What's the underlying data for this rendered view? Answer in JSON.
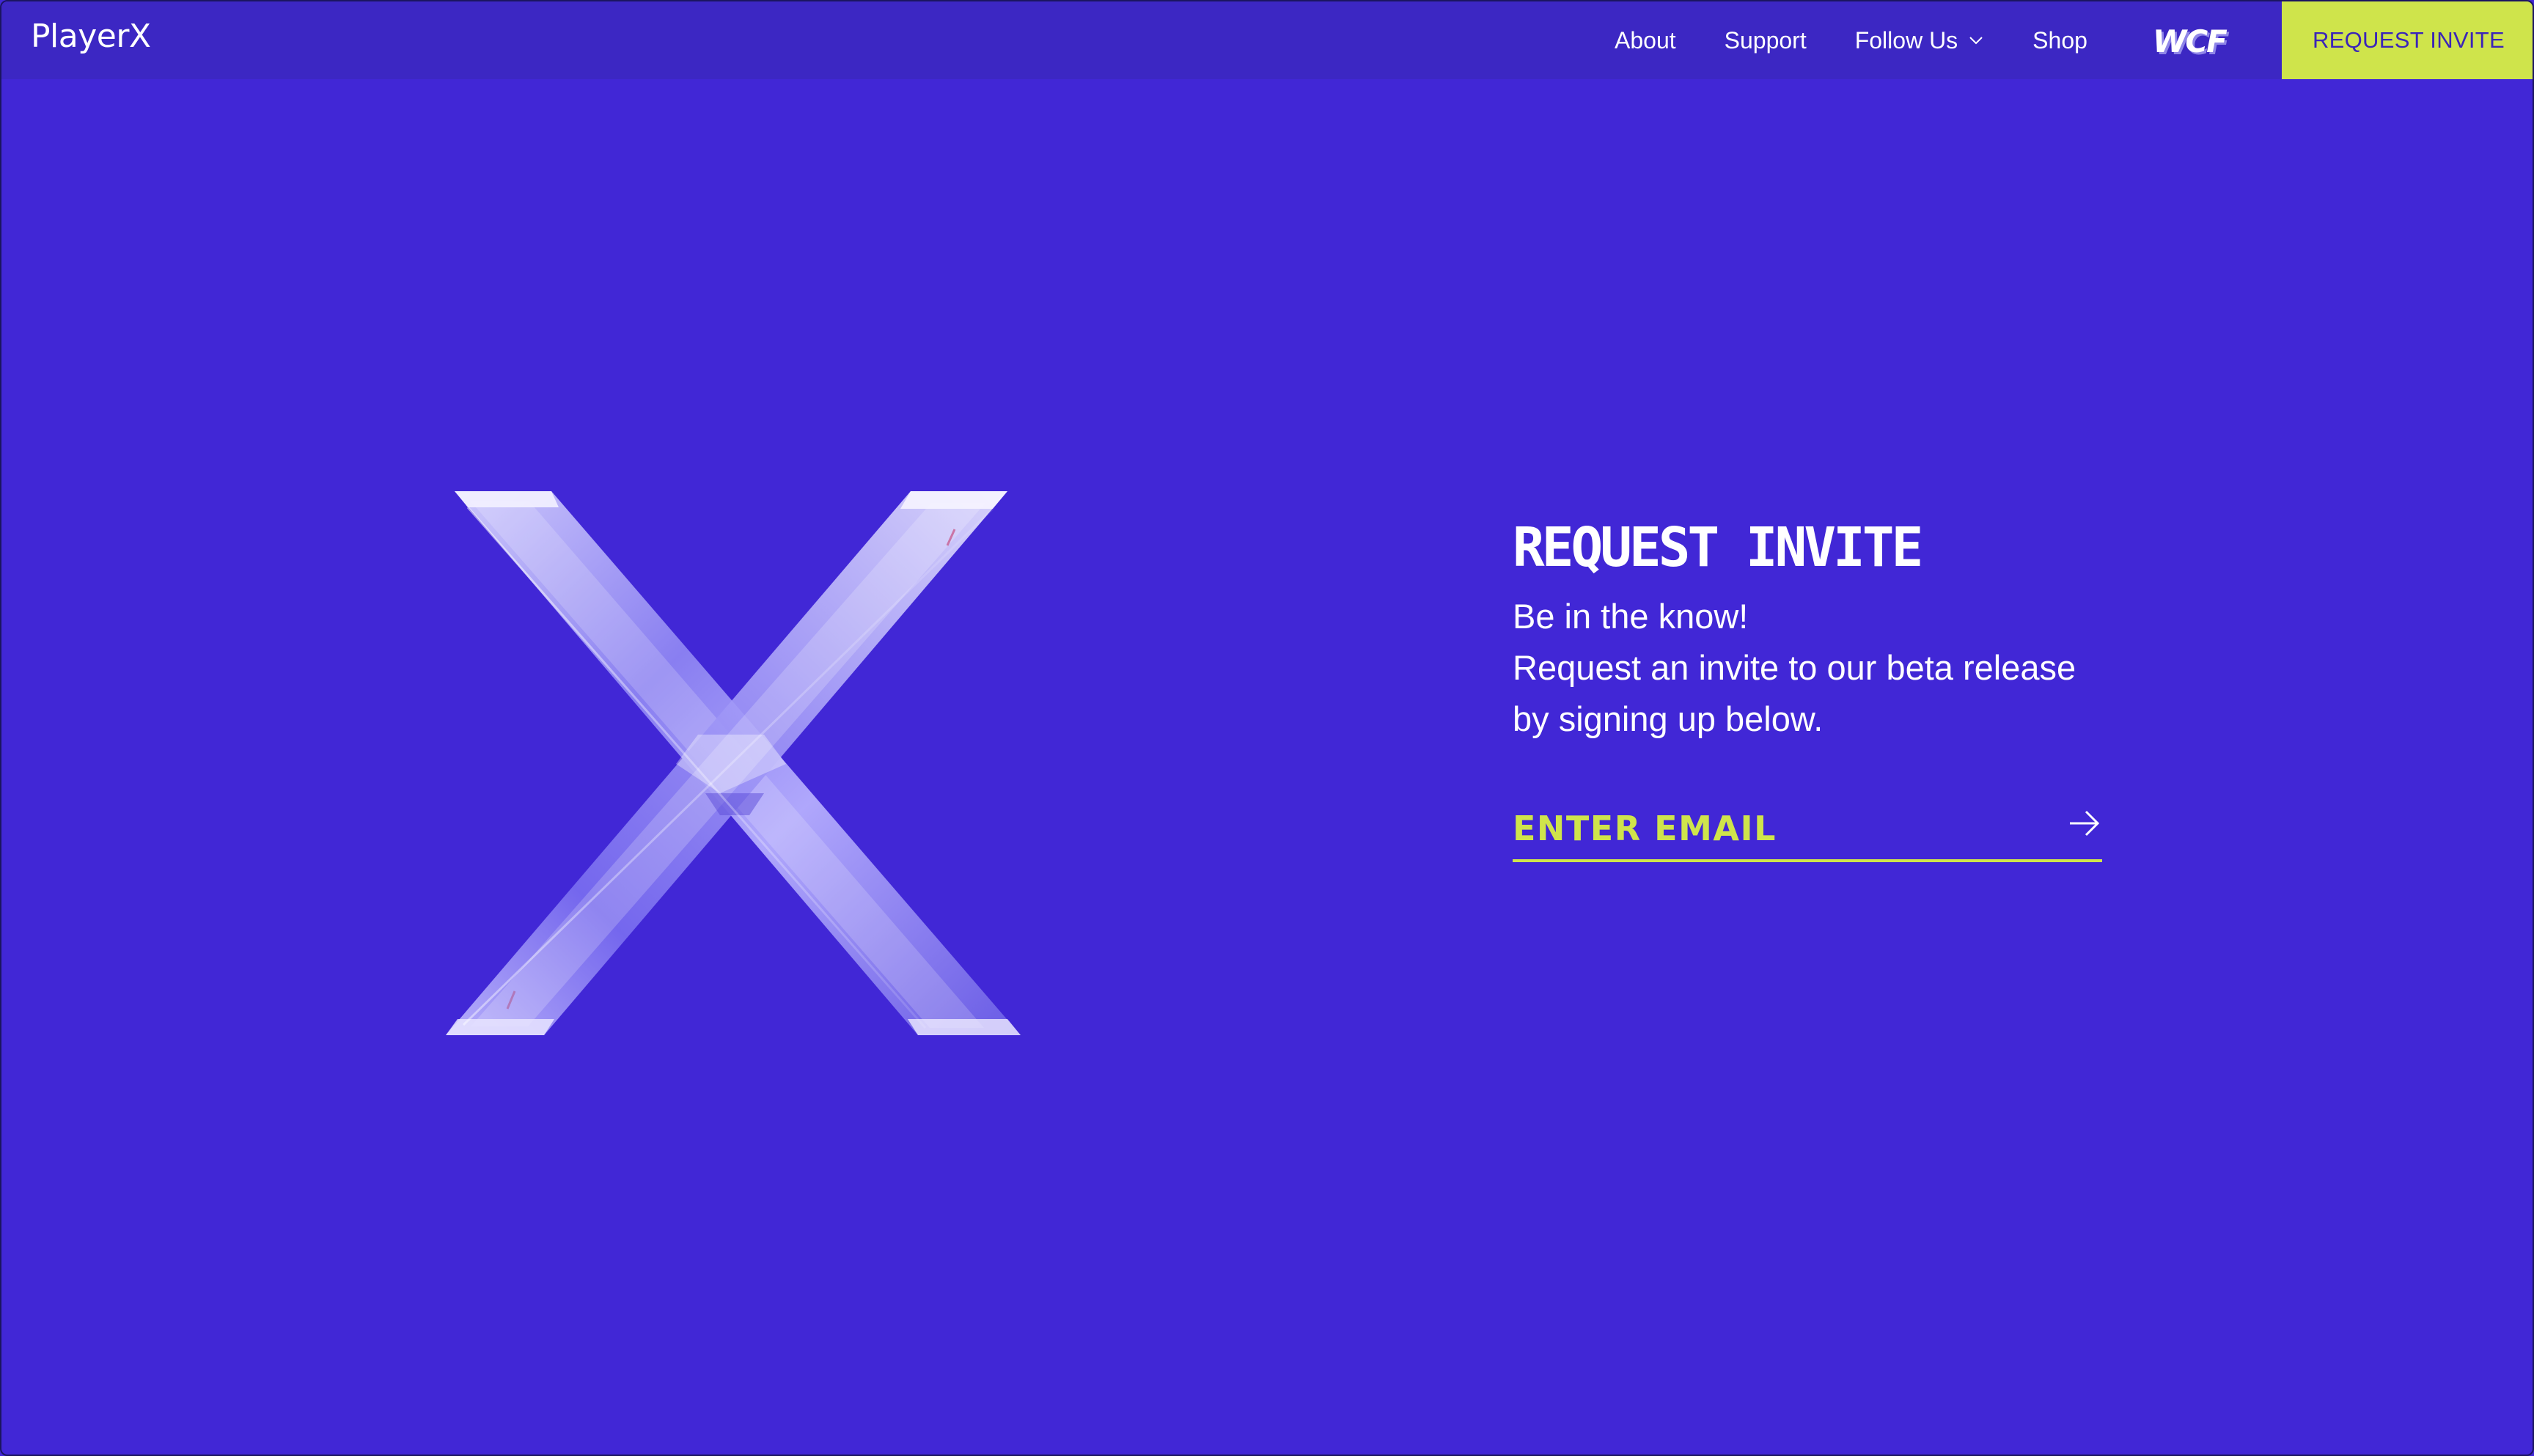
{
  "nav": {
    "brand": "PlayerX",
    "links": [
      {
        "label": "About"
      },
      {
        "label": "Support"
      },
      {
        "label": "Follow Us"
      },
      {
        "label": "Shop"
      }
    ],
    "partner_logo": "WCF",
    "cta_label": "REQUEST INVITE"
  },
  "hero": {
    "icon": "crystal-x-icon"
  },
  "panel": {
    "title": "REQUEST INVITE",
    "line1": "Be in the know!",
    "line2": "Request an invite to our beta release",
    "line3": "by signing up below.",
    "email_placeholder": "ENTER EMAIL",
    "submit_icon": "arrow-right-icon"
  },
  "colors": {
    "background": "#4127d6",
    "navbar": "#3c27c3",
    "accent": "#cfe44b",
    "text": "#ffffff",
    "cta_text": "#3b25b8"
  }
}
